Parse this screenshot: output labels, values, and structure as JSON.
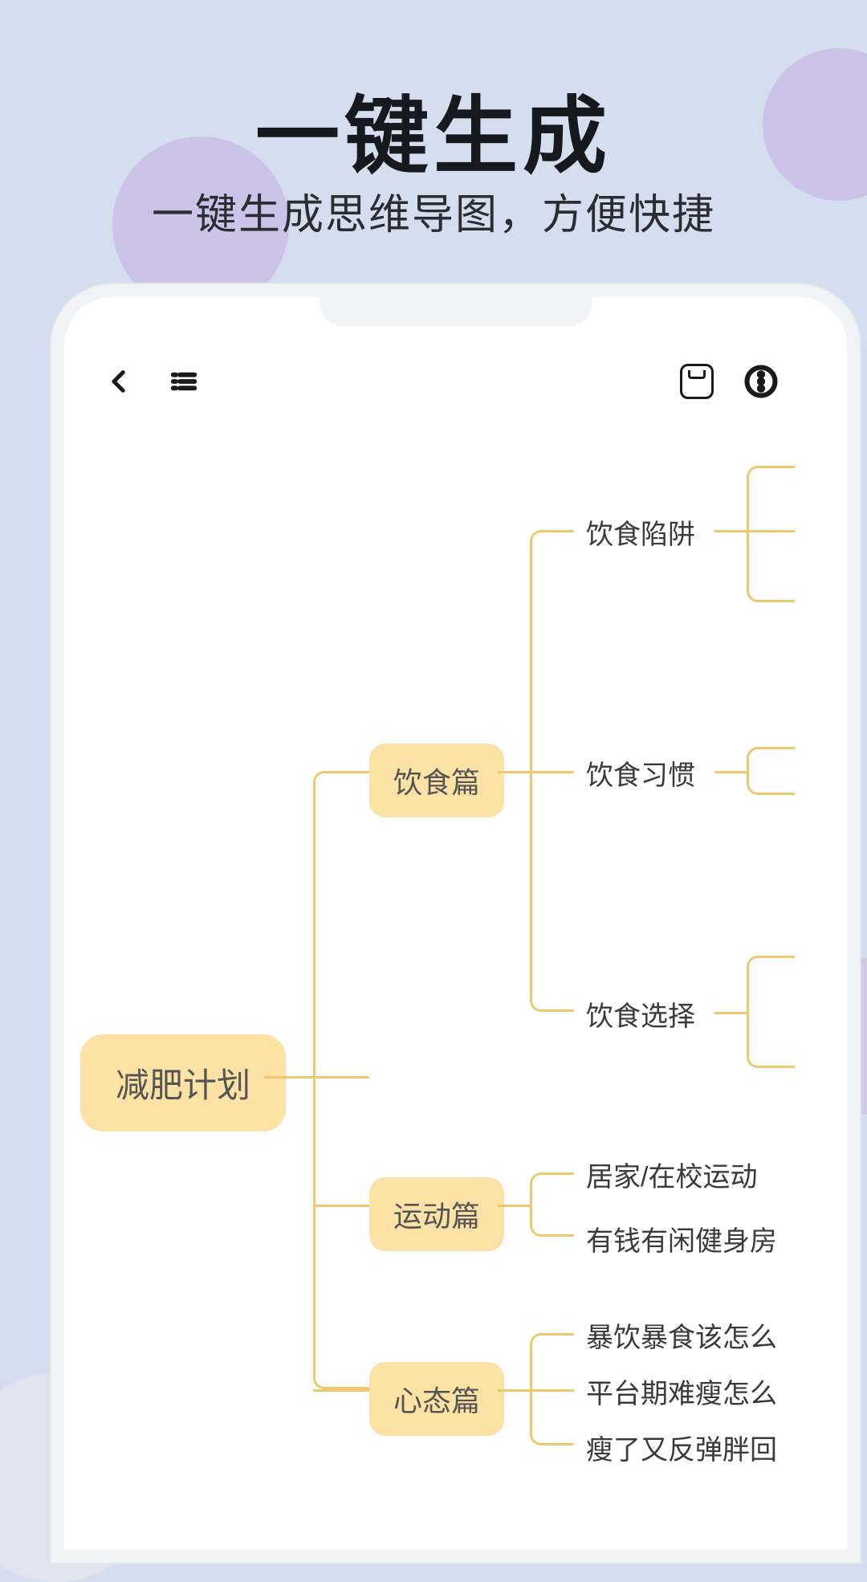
{
  "headline": "一键生成",
  "subhead": "一键生成思维导图，方便快捷",
  "mindmap": {
    "root": "减肥计划",
    "sections": {
      "diet": {
        "label": "饮食篇",
        "items": [
          "饮食陷阱",
          "饮食习惯",
          "饮食选择"
        ]
      },
      "sport": {
        "label": "运动篇",
        "items": [
          "居家/在校运动",
          "有钱有闲健身房"
        ]
      },
      "mind": {
        "label": "心态篇",
        "items": [
          "暴饮暴食该怎么",
          "平台期难瘦怎么",
          "瘦了又反弹胖回"
        ]
      }
    }
  }
}
